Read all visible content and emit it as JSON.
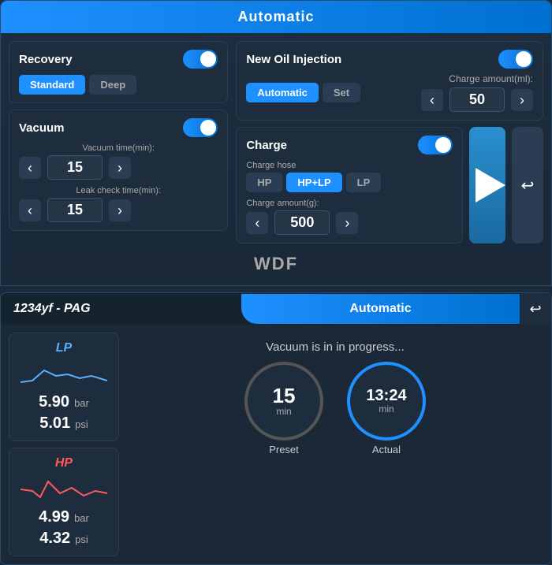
{
  "topPanel": {
    "header": "Automatic",
    "recovery": {
      "label": "Recovery",
      "toggle": "on",
      "modeButtons": [
        "Standard",
        "Deep"
      ],
      "activeMode": "Standard"
    },
    "newOilInjection": {
      "label": "New Oil Injection",
      "toggle": "on",
      "chargeAmountLabel": "Charge amount(ml):",
      "chargeAmount": "50",
      "modeButtons": [
        "Automatic",
        "Set"
      ],
      "activeMode": "Automatic"
    },
    "vacuum": {
      "label": "Vacuum",
      "toggle": "on",
      "vacuumTimeLabel": "Vacuum time(min):",
      "vacuumTime": "15",
      "leakCheckLabel": "Leak check time(min):",
      "leakCheckTime": "15"
    },
    "charge": {
      "label": "Charge",
      "toggle": "on",
      "chargeHoseLabel": "Charge hose",
      "hoseButtons": [
        "HP",
        "HP+LP",
        "LP"
      ],
      "activeHose": "HP+LP",
      "chargeAmountLabel": "Charge amount(g):",
      "chargeAmount": "500"
    },
    "backButton": "↩",
    "playButton": "▶",
    "logo": "WDF"
  },
  "bottomPanel": {
    "refrigerant": "1234yf - PAG",
    "mode": "Automatic",
    "statusText": "Vacuum is in in progress...",
    "lp": {
      "label": "LP",
      "bar": "5.90",
      "psi": "5.01"
    },
    "hp": {
      "label": "HP",
      "bar": "4.99",
      "psi": "4.32"
    },
    "presetTimer": {
      "value": "15",
      "unit": "min",
      "label": "Preset"
    },
    "actualTimer": {
      "value": "13:24",
      "unit": "min",
      "label": "Actual"
    },
    "backButton": "↩"
  }
}
